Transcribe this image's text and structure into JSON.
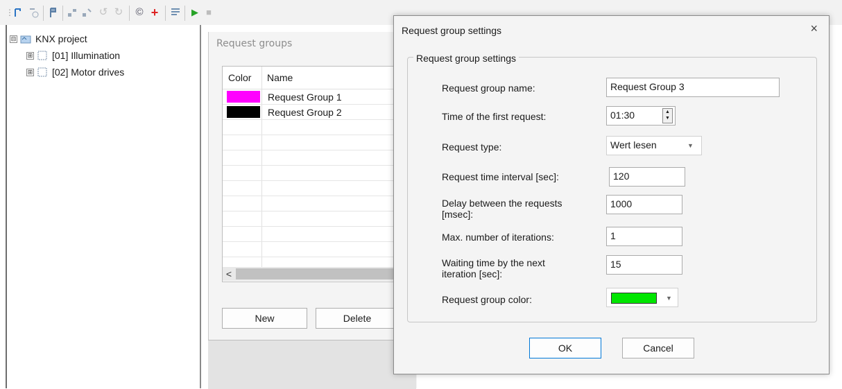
{
  "colors": {
    "magenta": "#ff00ff",
    "black": "#000000",
    "green": "#00e600",
    "accent": "#0078d7"
  },
  "toolbar": {
    "icons": [
      "grip-icon",
      "add-node-icon",
      "add-sub-icon",
      "flag-icon",
      "move-in-icon",
      "move-out-icon",
      "undo-icon",
      "redo-icon",
      "copyright-icon",
      "red-cross-icon",
      "list-icon",
      "play-icon",
      "stop-icon"
    ]
  },
  "tree": {
    "root": {
      "expander": "⊟",
      "label": "KNX project"
    },
    "items": [
      {
        "expander": "⊞",
        "label": "[01] Illumination"
      },
      {
        "expander": "⊞",
        "label": "[02] Motor drives"
      }
    ]
  },
  "request_groups": {
    "title": "Request groups",
    "columns": [
      "Color",
      "Name"
    ],
    "rows": [
      {
        "color": "#ff00ff",
        "name": "Request Group 1"
      },
      {
        "color": "#000000",
        "name": "Request Group 2"
      }
    ],
    "scroll_left": "<",
    "new_label": "New",
    "delete_label": "Delete"
  },
  "dialog": {
    "title": "Request group settings",
    "close": "×",
    "group_label": "Request group settings",
    "fields": {
      "name_label": "Request group name:",
      "name_value": "Request Group 3",
      "time_label": "Time of the first request:",
      "time_value": "01:30",
      "type_label": "Request type:",
      "type_value": "Wert lesen",
      "interval_label": "Request time interval [sec]:",
      "interval_value": "120",
      "delay_label_1": "Delay between the requests",
      "delay_label_2": "[msec]:",
      "delay_value": "1000",
      "max_label": "Max. number of iterations:",
      "max_value": "1",
      "wait_label_1": "Waiting time by the next",
      "wait_label_2": "iteration [sec]:",
      "wait_value": "15",
      "color_label": "Request group color:",
      "color_value": "#00e600"
    },
    "ok_label": "OK",
    "cancel_label": "Cancel"
  }
}
